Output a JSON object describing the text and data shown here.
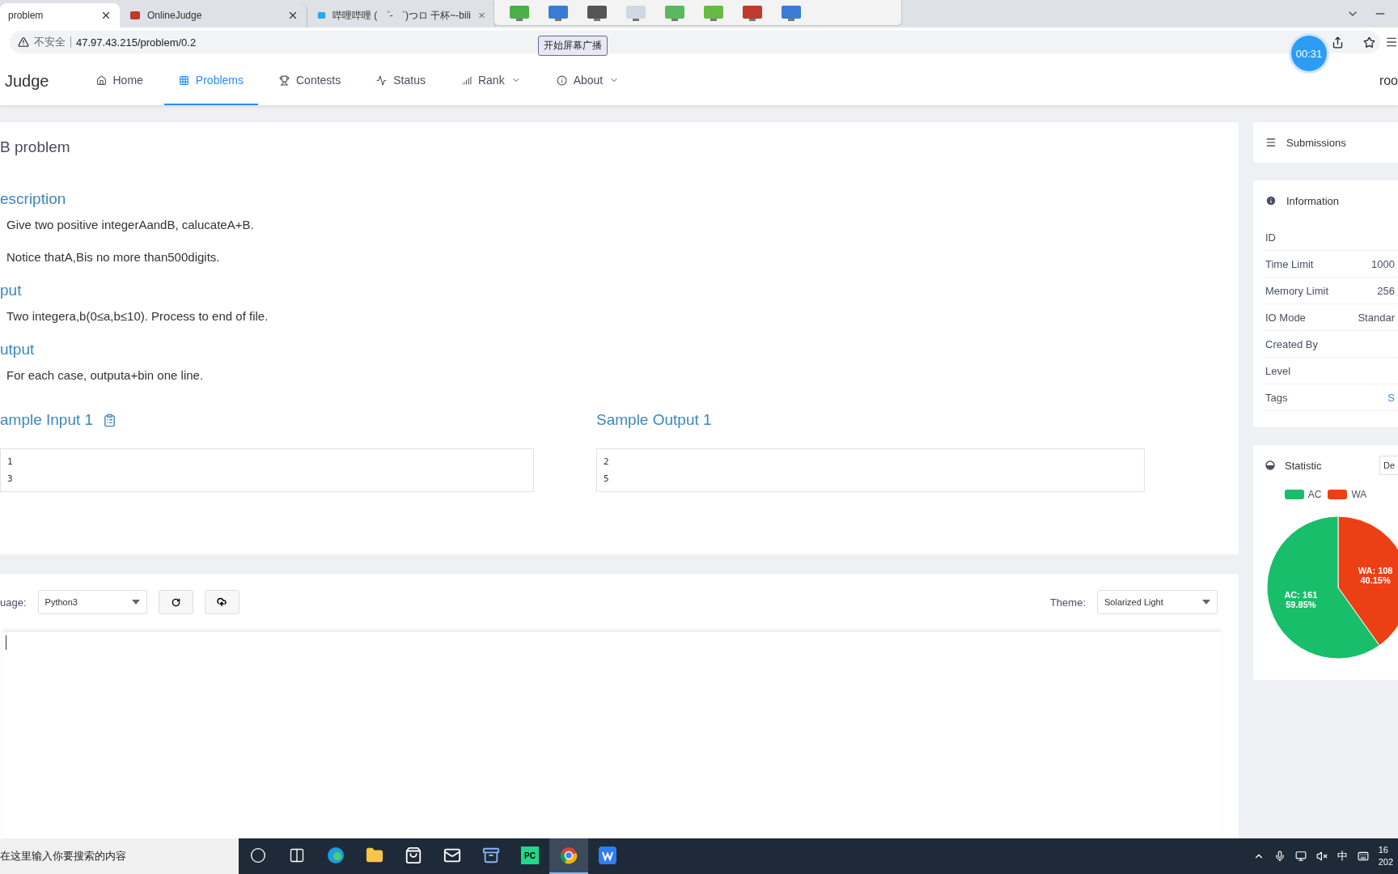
{
  "browser": {
    "tabs": [
      {
        "title": "problem",
        "selected": true
      },
      {
        "title": "OnlineJudge",
        "selected": false
      },
      {
        "title": "哔哩哔哩 ( ゜- ゜)つロ 干杯~-bili",
        "selected": false
      }
    ],
    "security": "不安全",
    "url": "47.97.43.215/problem/0.2"
  },
  "recorder": {
    "tooltip": "开始屏幕广播"
  },
  "timer": "00:31",
  "nav": {
    "brand": "Judge",
    "items": [
      {
        "label": "Home",
        "selected": false,
        "dropdown": false
      },
      {
        "label": "Problems",
        "selected": true,
        "dropdown": false
      },
      {
        "label": "Contests",
        "selected": false,
        "dropdown": false
      },
      {
        "label": "Status",
        "selected": false,
        "dropdown": false
      },
      {
        "label": "Rank",
        "selected": false,
        "dropdown": true
      },
      {
        "label": "About",
        "selected": false,
        "dropdown": true
      }
    ],
    "user": "roo"
  },
  "problem": {
    "title": "B problem",
    "sections": [
      {
        "heading": "escription",
        "paragraphs": [
          "Give two positive integerAandB, calucateA+B.",
          "Notice thatA,Bis no more than500digits."
        ]
      },
      {
        "heading": "put",
        "paragraphs": [
          "Two integera,b(0≤a,b≤10). Process to end of file."
        ]
      },
      {
        "heading": "utput",
        "paragraphs": [
          "For each case, outputa+bin one line."
        ]
      }
    ],
    "samples": [
      {
        "heading": "ample Input 1",
        "lines": [
          "1",
          "3"
        ]
      },
      {
        "heading": "Sample Output 1",
        "lines": [
          "2",
          "5"
        ]
      }
    ]
  },
  "editor": {
    "language_label": "uage:",
    "language": "Python3",
    "theme_label": "Theme:",
    "theme": "Solarized Light"
  },
  "sidebar": {
    "submissions": "Submissions",
    "information": {
      "title": "Information",
      "rows": [
        {
          "label": "ID"
        },
        {
          "label": "Time Limit",
          "value": "1000"
        },
        {
          "label": "Memory Limit",
          "value": "256"
        },
        {
          "label": "IO Mode",
          "value": "Standar"
        },
        {
          "label": "Created By"
        },
        {
          "label": "Level"
        },
        {
          "label": "Tags",
          "value": "S",
          "kind": "link"
        }
      ]
    },
    "statistic": {
      "title": "Statistic",
      "select": "De",
      "chart_data": {
        "type": "pie",
        "categories": [
          "AC",
          "WA"
        ],
        "values": [
          59.85,
          40.15
        ],
        "colors": [
          "#19be6b",
          "#ed3f14"
        ],
        "value_labels": [
          [
            "AC: 161",
            "59.85%"
          ],
          [
            "WA: 108",
            "40.15%"
          ]
        ]
      }
    }
  },
  "taskbar": {
    "search_placeholder": "在这里输入你要搜索的内容",
    "apps": [
      {
        "selected": false
      },
      {
        "selected": false
      },
      {
        "selected": false
      },
      {
        "selected": false
      },
      {
        "selected": false
      },
      {
        "selected": false
      },
      {
        "selected": false
      },
      {
        "label": "PC",
        "selected": false
      },
      {
        "selected": true
      },
      {
        "selected": false
      }
    ],
    "ime": "中",
    "clock": [
      "16",
      "202"
    ]
  }
}
